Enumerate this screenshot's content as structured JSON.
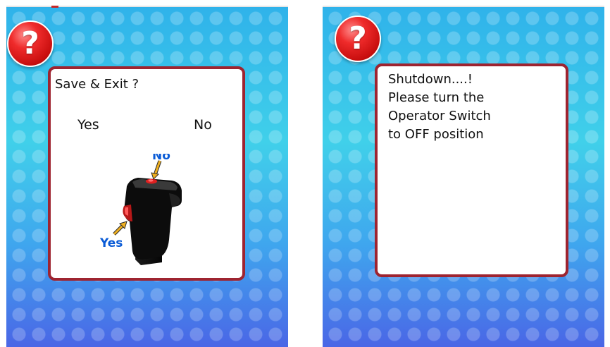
{
  "left_screen": {
    "dialog": {
      "title": "Save & Exit ?",
      "yes_label": "Yes",
      "no_label": "No",
      "lever_no_label": "No",
      "lever_yes_label": "Yes"
    }
  },
  "right_screen": {
    "dialog": {
      "lines": [
        "Shutdown....!",
        "Please turn the",
        "Operator Switch",
        "to OFF position"
      ]
    }
  },
  "help_icon_glyph": "?",
  "colors": {
    "dialog_border": "#9e2430",
    "help_badge": "#d91818",
    "lever_label": "#0a5bd6",
    "background_top": "#2fb2ea",
    "background_bottom": "#4a66e6"
  },
  "icons": [
    "help-icon",
    "joystick-lever-icon",
    "arrow-pointer-icon"
  ]
}
